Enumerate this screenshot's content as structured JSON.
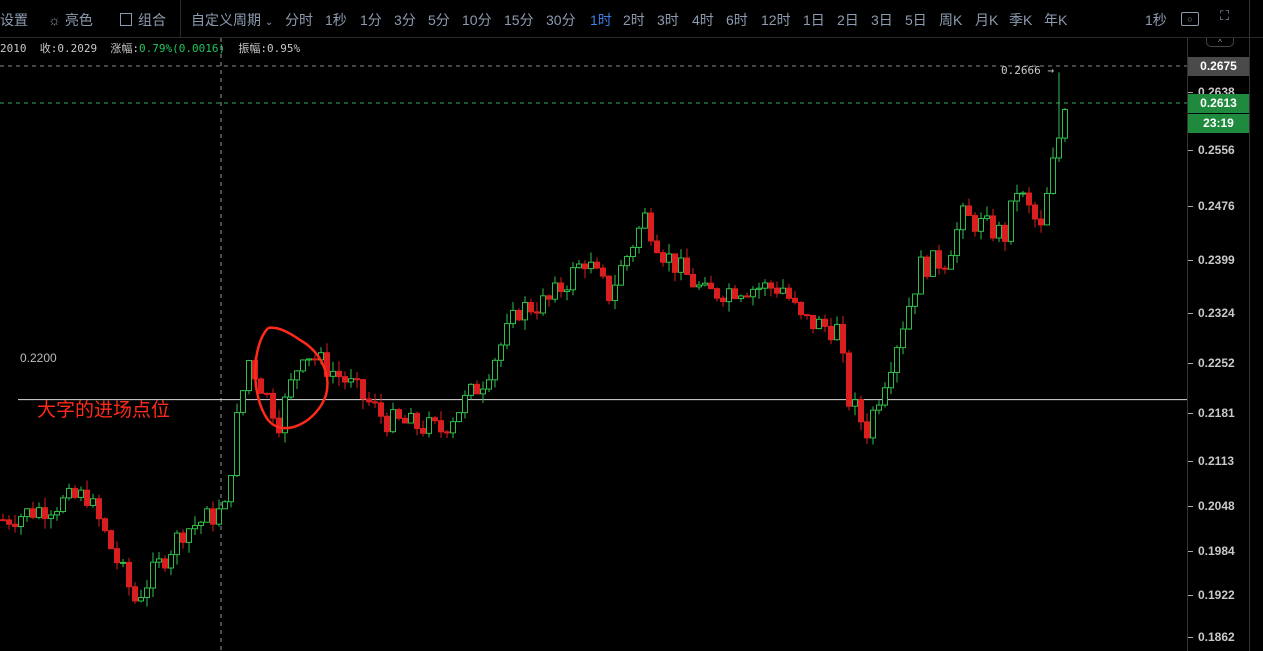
{
  "toolbar": {
    "settings": "设置",
    "bright": "亮色",
    "combo": "组合",
    "custom_period": "自定义周期",
    "periods": [
      "分时",
      "1秒",
      "1分",
      "3分",
      "5分",
      "10分",
      "15分",
      "30分",
      "1时",
      "2时",
      "3时",
      "4时",
      "6时",
      "12时",
      "1日",
      "2日",
      "3日",
      "5日",
      "周K",
      "月K",
      "季K",
      "年K"
    ],
    "active_period": "1时",
    "refresh": "1秒"
  },
  "info": {
    "prefix": "2010",
    "close_label": "收:",
    "close": "0.2029",
    "change_label": "涨幅:",
    "change": "0.79%(0.0016)",
    "amp_label": "振幅:",
    "amp": "0.95%"
  },
  "axis": {
    "labels": [
      "0.2638",
      "0.2556",
      "0.2476",
      "0.2399",
      "0.2324",
      "0.2252",
      "0.2181",
      "0.2113",
      "0.2048",
      "0.1984",
      "0.1922",
      "0.1862"
    ],
    "high_badge": "0.2675",
    "last_badge": "0.2613",
    "countdown": "23:19"
  },
  "annotations": {
    "high_marker": "0.2666 →",
    "level_label": "0.2200",
    "note": "大字的进场点位"
  },
  "colors": {
    "up": "#2fbf4a",
    "down": "#d81e1e",
    "last": "#1f8a3e",
    "annotation": "#ff2a1a"
  },
  "chart_data": {
    "type": "candlestick",
    "price_range": [
      0.184,
      0.269
    ],
    "level_line": 0.22,
    "path_keypoints": [
      [
        0,
        0.2029
      ],
      [
        14,
        0.2064
      ],
      [
        22,
        0.1915
      ],
      [
        30,
        0.2014
      ],
      [
        37,
        0.2043
      ],
      [
        39,
        0.217
      ],
      [
        41,
        0.2256
      ],
      [
        46,
        0.217
      ],
      [
        50,
        0.2271
      ],
      [
        57,
        0.2228
      ],
      [
        64,
        0.217
      ],
      [
        73,
        0.2157
      ],
      [
        80,
        0.2228
      ],
      [
        86,
        0.2328
      ],
      [
        91,
        0.234
      ],
      [
        97,
        0.2399
      ],
      [
        101,
        0.235
      ],
      [
        107,
        0.246
      ],
      [
        110,
        0.241
      ],
      [
        117,
        0.235
      ],
      [
        123,
        0.236
      ],
      [
        130,
        0.236
      ],
      [
        133,
        0.2313
      ],
      [
        139,
        0.23
      ],
      [
        141,
        0.22
      ],
      [
        144,
        0.2157
      ],
      [
        148,
        0.2256
      ],
      [
        153,
        0.239
      ],
      [
        157,
        0.2399
      ],
      [
        160,
        0.246
      ],
      [
        167,
        0.2434
      ],
      [
        169,
        0.25
      ],
      [
        173,
        0.244
      ],
      [
        175,
        0.2534
      ],
      [
        177,
        0.2613
      ]
    ]
  }
}
